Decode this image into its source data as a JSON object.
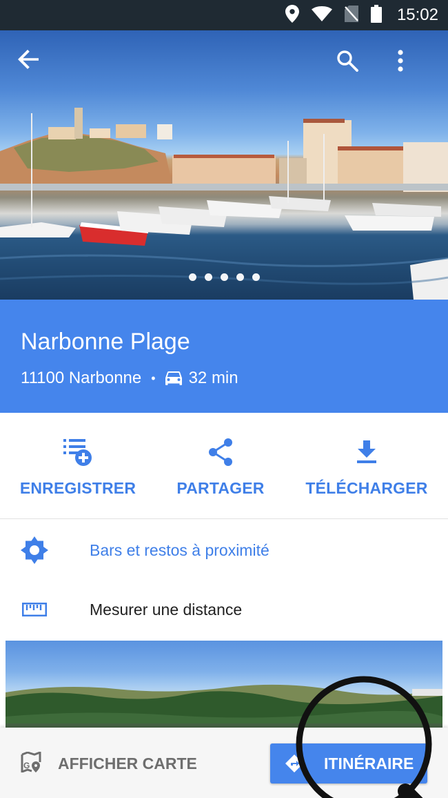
{
  "status_bar": {
    "time": "15:02"
  },
  "hero": {
    "photo_count": 5,
    "active_photo": 1
  },
  "place": {
    "name": "Narbonne Plage",
    "postal_city": "11100 Narbonne",
    "separator": "•",
    "drive_time": "32 min"
  },
  "actions": [
    {
      "label": "ENREGISTRER",
      "icon": "add-to-list-icon"
    },
    {
      "label": "PARTAGER",
      "icon": "share-icon"
    },
    {
      "label": "TÉLÉCHARGER",
      "icon": "download-icon"
    }
  ],
  "rows": [
    {
      "label": "Bars et restos à proximité",
      "icon": "explore-nearby-icon",
      "color": "#3f7fe8"
    },
    {
      "label": "Mesurer une distance",
      "icon": "ruler-icon",
      "color": "#212121"
    }
  ],
  "bottom_bar": {
    "map_label": "AFFICHER CARTE",
    "route_label": "ITINÉRAIRE"
  },
  "colors": {
    "accent": "#4585ec",
    "link": "#3f7fe8",
    "status_bar": "#1f2a33"
  }
}
